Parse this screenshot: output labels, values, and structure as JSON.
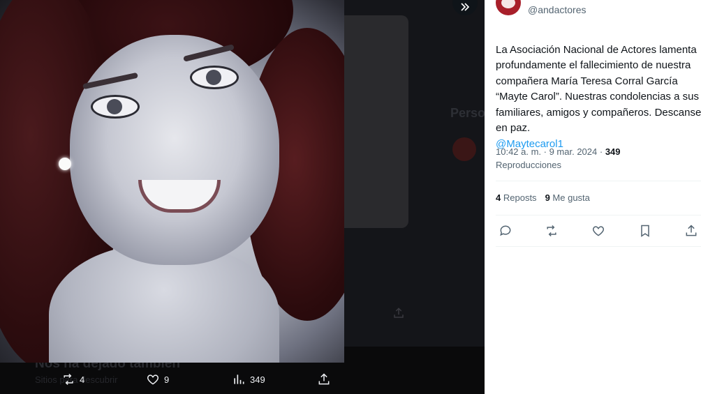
{
  "media_viewer": {
    "faded_heading": "Nos ha dejado tambien",
    "faded_subtext": "Sitios para descubrir",
    "sidebar_heading": "Perso",
    "actions": {
      "retweets": "4",
      "likes": "9",
      "views": "349"
    }
  },
  "tweet": {
    "handle": "@andactores",
    "text": "La Asociación Nacional de Actores lamenta profundamente el fallecimiento de nuestra compañera María Teresa Corral García “Mayte Carol”. Nuestras condolencias a sus familiares, amigos y compañeros. Descanse en paz.",
    "mention": "@Maytecarol1",
    "timestamp": "10:42 a. m. · 9 mar. 2024 · ",
    "views_count": "349",
    "views_label": "Reproducciones",
    "reposts_count": "4",
    "reposts_label": "Reposts",
    "likes_count": "9",
    "likes_label": "Me gusta"
  },
  "colors": {
    "accent": "#1d9bf0",
    "text_primary": "#0f1419",
    "text_secondary": "#536471",
    "viewer_bg": "#121316",
    "avatar": "#a81f2a"
  }
}
